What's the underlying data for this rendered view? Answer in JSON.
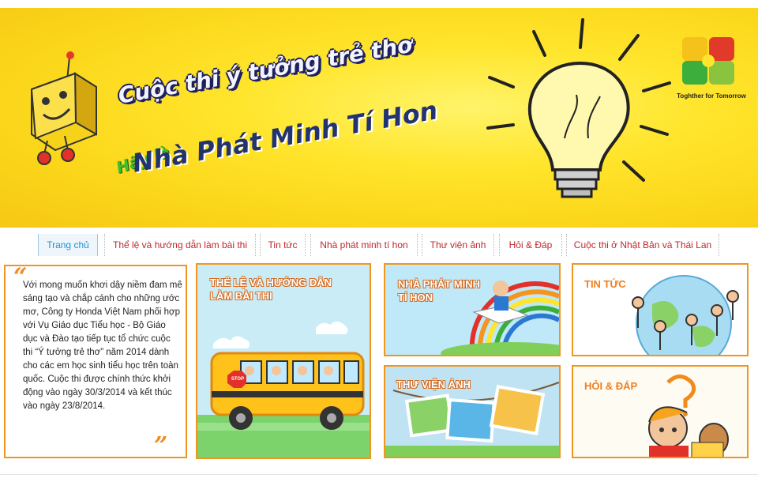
{
  "banner": {
    "title_line1": "Cuộc thi ý tưởng trẻ thơ",
    "title_hay_la": "Hãy là",
    "title_line2": "Nhà Phát Minh Tí Hon",
    "logo_caption": "Toghther for Tomorrow"
  },
  "nav": {
    "items": [
      {
        "label": "Trang chủ"
      },
      {
        "label": "Thể lệ và hướng dẫn làm bài thi"
      },
      {
        "label": "Tin tức"
      },
      {
        "label": "Nhà phát minh tí hon"
      },
      {
        "label": "Thư viện ảnh"
      },
      {
        "label": "Hỏi & Đáp"
      },
      {
        "label": "Cuộc thi ở Nhật Bản và Thái Lan"
      }
    ]
  },
  "intro": {
    "text": "Với mong muốn khơi dậy niềm đam mê sáng tạo và chắp cánh cho những ước mơ, Công ty Honda Việt Nam phối hợp với Vụ Giáo dục Tiểu học - Bộ Giáo dục và Đào tạo tiếp tục tổ chức cuộc thi “Ý tưởng trẻ thơ” năm 2014 dành cho các em học sinh tiểu học trên toàn quốc. Cuộc thi được chính thức khởi động vào ngày 30/3/2014 và kết thúc vào ngày 23/8/2014."
  },
  "cards": {
    "rules_line1": "THỂ LỆ VÀ HƯỚNG DẪN",
    "rules_line2": "LÀM BÀI THI",
    "inventor_line1": "NHÀ PHÁT MINH",
    "inventor_line2": "TÍ HON",
    "news": "TIN TỨC",
    "gallery": "THƯ VIỆN ẢNH",
    "faq": "HỎI & ĐÁP",
    "stop_sign": "STOP"
  },
  "colors": {
    "banner_yellow": "#ffe52c",
    "nav_text": "#c0272d",
    "nav_active": "#1e90d2",
    "card_border": "#f0961e"
  }
}
